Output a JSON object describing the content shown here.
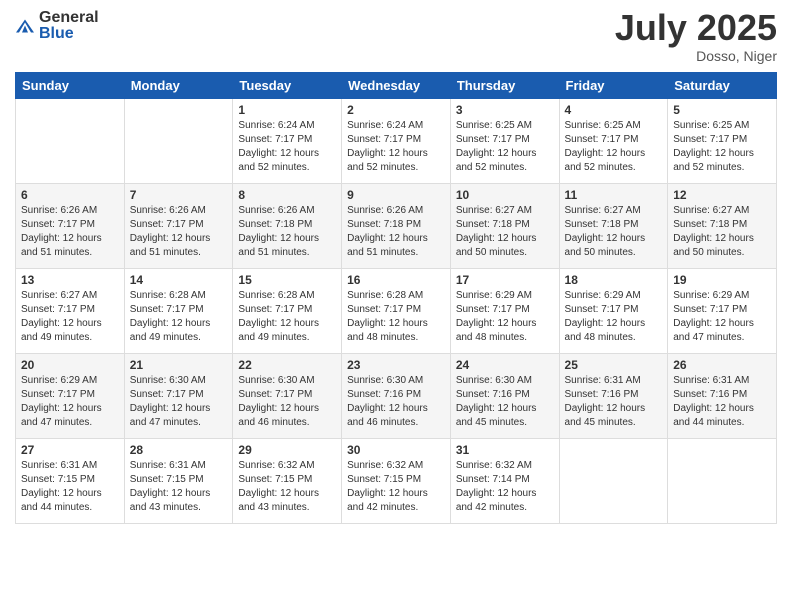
{
  "logo": {
    "general": "General",
    "blue": "Blue"
  },
  "header": {
    "month": "July 2025",
    "location": "Dosso, Niger"
  },
  "weekdays": [
    "Sunday",
    "Monday",
    "Tuesday",
    "Wednesday",
    "Thursday",
    "Friday",
    "Saturday"
  ],
  "weeks": [
    [
      {
        "day": "",
        "info": ""
      },
      {
        "day": "",
        "info": ""
      },
      {
        "day": "1",
        "info": "Sunrise: 6:24 AM\nSunset: 7:17 PM\nDaylight: 12 hours and 52 minutes."
      },
      {
        "day": "2",
        "info": "Sunrise: 6:24 AM\nSunset: 7:17 PM\nDaylight: 12 hours and 52 minutes."
      },
      {
        "day": "3",
        "info": "Sunrise: 6:25 AM\nSunset: 7:17 PM\nDaylight: 12 hours and 52 minutes."
      },
      {
        "day": "4",
        "info": "Sunrise: 6:25 AM\nSunset: 7:17 PM\nDaylight: 12 hours and 52 minutes."
      },
      {
        "day": "5",
        "info": "Sunrise: 6:25 AM\nSunset: 7:17 PM\nDaylight: 12 hours and 52 minutes."
      }
    ],
    [
      {
        "day": "6",
        "info": "Sunrise: 6:26 AM\nSunset: 7:17 PM\nDaylight: 12 hours and 51 minutes."
      },
      {
        "day": "7",
        "info": "Sunrise: 6:26 AM\nSunset: 7:17 PM\nDaylight: 12 hours and 51 minutes."
      },
      {
        "day": "8",
        "info": "Sunrise: 6:26 AM\nSunset: 7:18 PM\nDaylight: 12 hours and 51 minutes."
      },
      {
        "day": "9",
        "info": "Sunrise: 6:26 AM\nSunset: 7:18 PM\nDaylight: 12 hours and 51 minutes."
      },
      {
        "day": "10",
        "info": "Sunrise: 6:27 AM\nSunset: 7:18 PM\nDaylight: 12 hours and 50 minutes."
      },
      {
        "day": "11",
        "info": "Sunrise: 6:27 AM\nSunset: 7:18 PM\nDaylight: 12 hours and 50 minutes."
      },
      {
        "day": "12",
        "info": "Sunrise: 6:27 AM\nSunset: 7:18 PM\nDaylight: 12 hours and 50 minutes."
      }
    ],
    [
      {
        "day": "13",
        "info": "Sunrise: 6:27 AM\nSunset: 7:17 PM\nDaylight: 12 hours and 49 minutes."
      },
      {
        "day": "14",
        "info": "Sunrise: 6:28 AM\nSunset: 7:17 PM\nDaylight: 12 hours and 49 minutes."
      },
      {
        "day": "15",
        "info": "Sunrise: 6:28 AM\nSunset: 7:17 PM\nDaylight: 12 hours and 49 minutes."
      },
      {
        "day": "16",
        "info": "Sunrise: 6:28 AM\nSunset: 7:17 PM\nDaylight: 12 hours and 48 minutes."
      },
      {
        "day": "17",
        "info": "Sunrise: 6:29 AM\nSunset: 7:17 PM\nDaylight: 12 hours and 48 minutes."
      },
      {
        "day": "18",
        "info": "Sunrise: 6:29 AM\nSunset: 7:17 PM\nDaylight: 12 hours and 48 minutes."
      },
      {
        "day": "19",
        "info": "Sunrise: 6:29 AM\nSunset: 7:17 PM\nDaylight: 12 hours and 47 minutes."
      }
    ],
    [
      {
        "day": "20",
        "info": "Sunrise: 6:29 AM\nSunset: 7:17 PM\nDaylight: 12 hours and 47 minutes."
      },
      {
        "day": "21",
        "info": "Sunrise: 6:30 AM\nSunset: 7:17 PM\nDaylight: 12 hours and 47 minutes."
      },
      {
        "day": "22",
        "info": "Sunrise: 6:30 AM\nSunset: 7:17 PM\nDaylight: 12 hours and 46 minutes."
      },
      {
        "day": "23",
        "info": "Sunrise: 6:30 AM\nSunset: 7:16 PM\nDaylight: 12 hours and 46 minutes."
      },
      {
        "day": "24",
        "info": "Sunrise: 6:30 AM\nSunset: 7:16 PM\nDaylight: 12 hours and 45 minutes."
      },
      {
        "day": "25",
        "info": "Sunrise: 6:31 AM\nSunset: 7:16 PM\nDaylight: 12 hours and 45 minutes."
      },
      {
        "day": "26",
        "info": "Sunrise: 6:31 AM\nSunset: 7:16 PM\nDaylight: 12 hours and 44 minutes."
      }
    ],
    [
      {
        "day": "27",
        "info": "Sunrise: 6:31 AM\nSunset: 7:15 PM\nDaylight: 12 hours and 44 minutes."
      },
      {
        "day": "28",
        "info": "Sunrise: 6:31 AM\nSunset: 7:15 PM\nDaylight: 12 hours and 43 minutes."
      },
      {
        "day": "29",
        "info": "Sunrise: 6:32 AM\nSunset: 7:15 PM\nDaylight: 12 hours and 43 minutes."
      },
      {
        "day": "30",
        "info": "Sunrise: 6:32 AM\nSunset: 7:15 PM\nDaylight: 12 hours and 42 minutes."
      },
      {
        "day": "31",
        "info": "Sunrise: 6:32 AM\nSunset: 7:14 PM\nDaylight: 12 hours and 42 minutes."
      },
      {
        "day": "",
        "info": ""
      },
      {
        "day": "",
        "info": ""
      }
    ]
  ]
}
